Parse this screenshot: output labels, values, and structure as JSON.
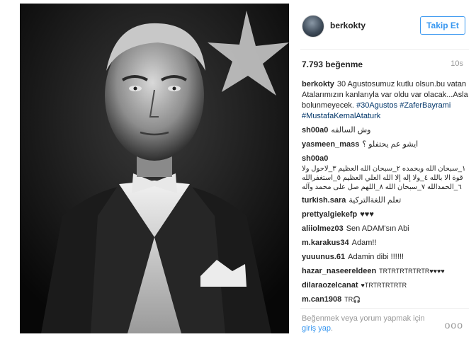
{
  "post": {
    "username": "berkokty",
    "follow_label": "Takip Et",
    "likes": "7.793 beğenme",
    "time": "10s"
  },
  "caption": {
    "user": "berkokty",
    "text": "30 Agustosumuz kutlu olsun.bu vatan Atalarımızın kanlarıyla var oldu var olacak...Asla bolunmeyecek.",
    "hashtags": [
      "#30Agustos",
      "#ZaferBayrami",
      "#MustafaKemalAtaturk"
    ]
  },
  "comments": [
    {
      "user": "sh00a0",
      "text": "وش السالفه"
    },
    {
      "user": "yasmeen_mass",
      "text": "ايشو عم يحتفلو ؟"
    },
    {
      "user": "sh00a0",
      "text": "١_سبحان الله وبحمده ٢_سبحان الله العظيم ٣_لاحول ولا قوة الا بالله ٤_ولا إله إلا الله العلي العظيم ٥_استغفرالله ٦_الحمدالله ٧_سبحان الله ٨_اللهم صل على محمد وآله"
    },
    {
      "user": "turkish.sara",
      "text": "تعلم اللغةالتركية"
    },
    {
      "user": "prettyalgiekefp",
      "text": "♥♥♥"
    },
    {
      "user": "aliiolmez03",
      "text": "Sen ADAM'sın Abi"
    },
    {
      "user": "m.karakus34",
      "text": "Adam!!"
    },
    {
      "user": "yuuunus.61",
      "text": "Adamin dibi !!!!!!"
    },
    {
      "user": "hazar_naseereldeen",
      "text": "TRTRTRTRTRTR♥♥♥♥"
    },
    {
      "user": "dilaraozelcanat",
      "text": "♥TRTRTRTRTR"
    },
    {
      "user": "m.can1908",
      "text": "TR🎧"
    }
  ],
  "footer": {
    "prompt": "Beğenmek veya yorum yapmak için",
    "login": "giriş yap",
    "period": ".",
    "more": "ooo"
  },
  "colors": {
    "link_blue": "#3897f0",
    "hashtag_blue": "#003569",
    "muted": "#999999"
  }
}
